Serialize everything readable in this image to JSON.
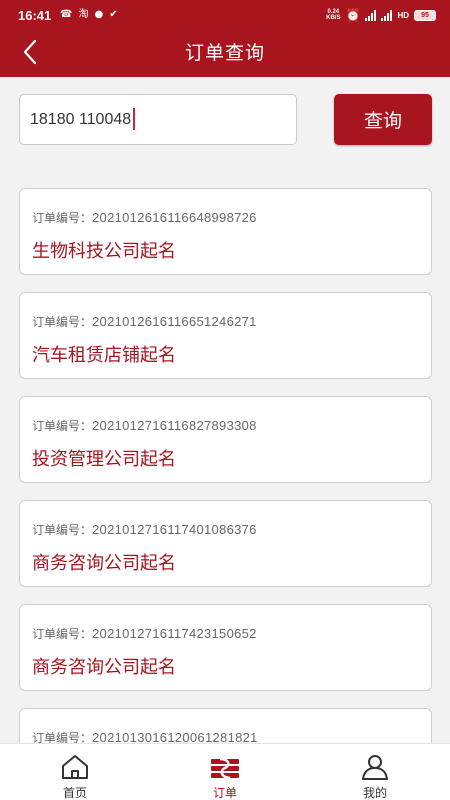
{
  "status_bar": {
    "time": "16:41",
    "net_speed_value": "0.24",
    "net_speed_unit": "KB/S",
    "network": "HD",
    "battery": "95"
  },
  "header": {
    "title": "订单查询"
  },
  "search": {
    "value": "18180 110048",
    "button_label": "查询"
  },
  "orders": [
    {
      "no_label": "订单编号：",
      "no": "2021012616116648998726",
      "name": "生物科技公司起名"
    },
    {
      "no_label": "订单编号：",
      "no": "2021012616116651246271",
      "name": "汽车租赁店铺起名"
    },
    {
      "no_label": "订单编号：",
      "no": "2021012716116827893308",
      "name": "投资管理公司起名"
    },
    {
      "no_label": "订单编号：",
      "no": "2021012716117401086376",
      "name": "商务咨询公司起名"
    },
    {
      "no_label": "订单编号：",
      "no": "2021012716117423150652",
      "name": "商务咨询公司起名"
    },
    {
      "no_label": "订单编号：",
      "no": "2021013016120061281821",
      "name": ""
    }
  ],
  "tabbar": {
    "items": [
      {
        "label": "首页",
        "icon": "home-icon"
      },
      {
        "label": "订单",
        "icon": "order-icon",
        "active": true
      },
      {
        "label": "我的",
        "icon": "user-icon"
      }
    ]
  },
  "colors": {
    "brand": "#a8151f",
    "background": "#f2f2f2"
  }
}
